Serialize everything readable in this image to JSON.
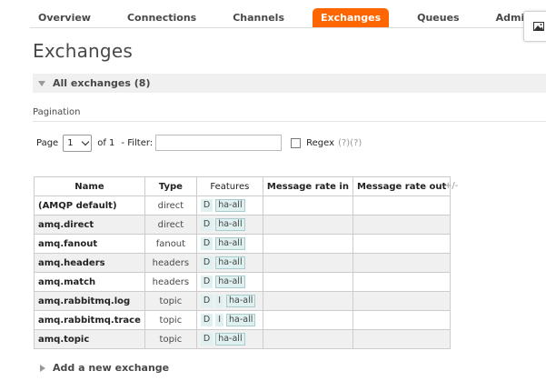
{
  "nav": {
    "tabs": [
      {
        "label": "Overview",
        "active": false
      },
      {
        "label": "Connections",
        "active": false
      },
      {
        "label": "Channels",
        "active": false
      },
      {
        "label": "Exchanges",
        "active": true
      },
      {
        "label": "Queues",
        "active": false
      },
      {
        "label": "Admin",
        "active": false
      }
    ]
  },
  "page_title": "Exchanges",
  "section_title": "All exchanges (8)",
  "pagination": {
    "heading": "Pagination",
    "page_label": "Page",
    "page_value": "1",
    "of_label": "of 1",
    "filter_label": "- Filter:",
    "filter_value": "",
    "regex_label": "Regex",
    "regex_help": "(?)(?)",
    "regex_checked": false
  },
  "table": {
    "headers": [
      "Name",
      "Type",
      "Features",
      "Message rate in",
      "Message rate out"
    ],
    "plusminus": "+/-",
    "rows": [
      {
        "name": "(AMQP default)",
        "type": "direct",
        "features": [
          "D",
          "ha-all"
        ],
        "rate_in": "",
        "rate_out": ""
      },
      {
        "name": "amq.direct",
        "type": "direct",
        "features": [
          "D",
          "ha-all"
        ],
        "rate_in": "",
        "rate_out": ""
      },
      {
        "name": "amq.fanout",
        "type": "fanout",
        "features": [
          "D",
          "ha-all"
        ],
        "rate_in": "",
        "rate_out": ""
      },
      {
        "name": "amq.headers",
        "type": "headers",
        "features": [
          "D",
          "ha-all"
        ],
        "rate_in": "",
        "rate_out": ""
      },
      {
        "name": "amq.match",
        "type": "headers",
        "features": [
          "D",
          "ha-all"
        ],
        "rate_in": "",
        "rate_out": ""
      },
      {
        "name": "amq.rabbitmq.log",
        "type": "topic",
        "features": [
          "D",
          "I",
          "ha-all"
        ],
        "rate_in": "",
        "rate_out": ""
      },
      {
        "name": "amq.rabbitmq.trace",
        "type": "topic",
        "features": [
          "D",
          "I",
          "ha-all"
        ],
        "rate_in": "",
        "rate_out": ""
      },
      {
        "name": "amq.topic",
        "type": "topic",
        "features": [
          "D",
          "ha-all"
        ],
        "rate_in": "",
        "rate_out": ""
      }
    ]
  },
  "add_section": "Add a new exchange",
  "colors": {
    "accent": "#ff6600",
    "section_bg": "#f0f0f0",
    "badge_bg": "#dff0f0"
  },
  "icons": {
    "corner": "image-icon",
    "section_toggle": "triangle-down-icon",
    "add_toggle": "triangle-right-icon"
  }
}
